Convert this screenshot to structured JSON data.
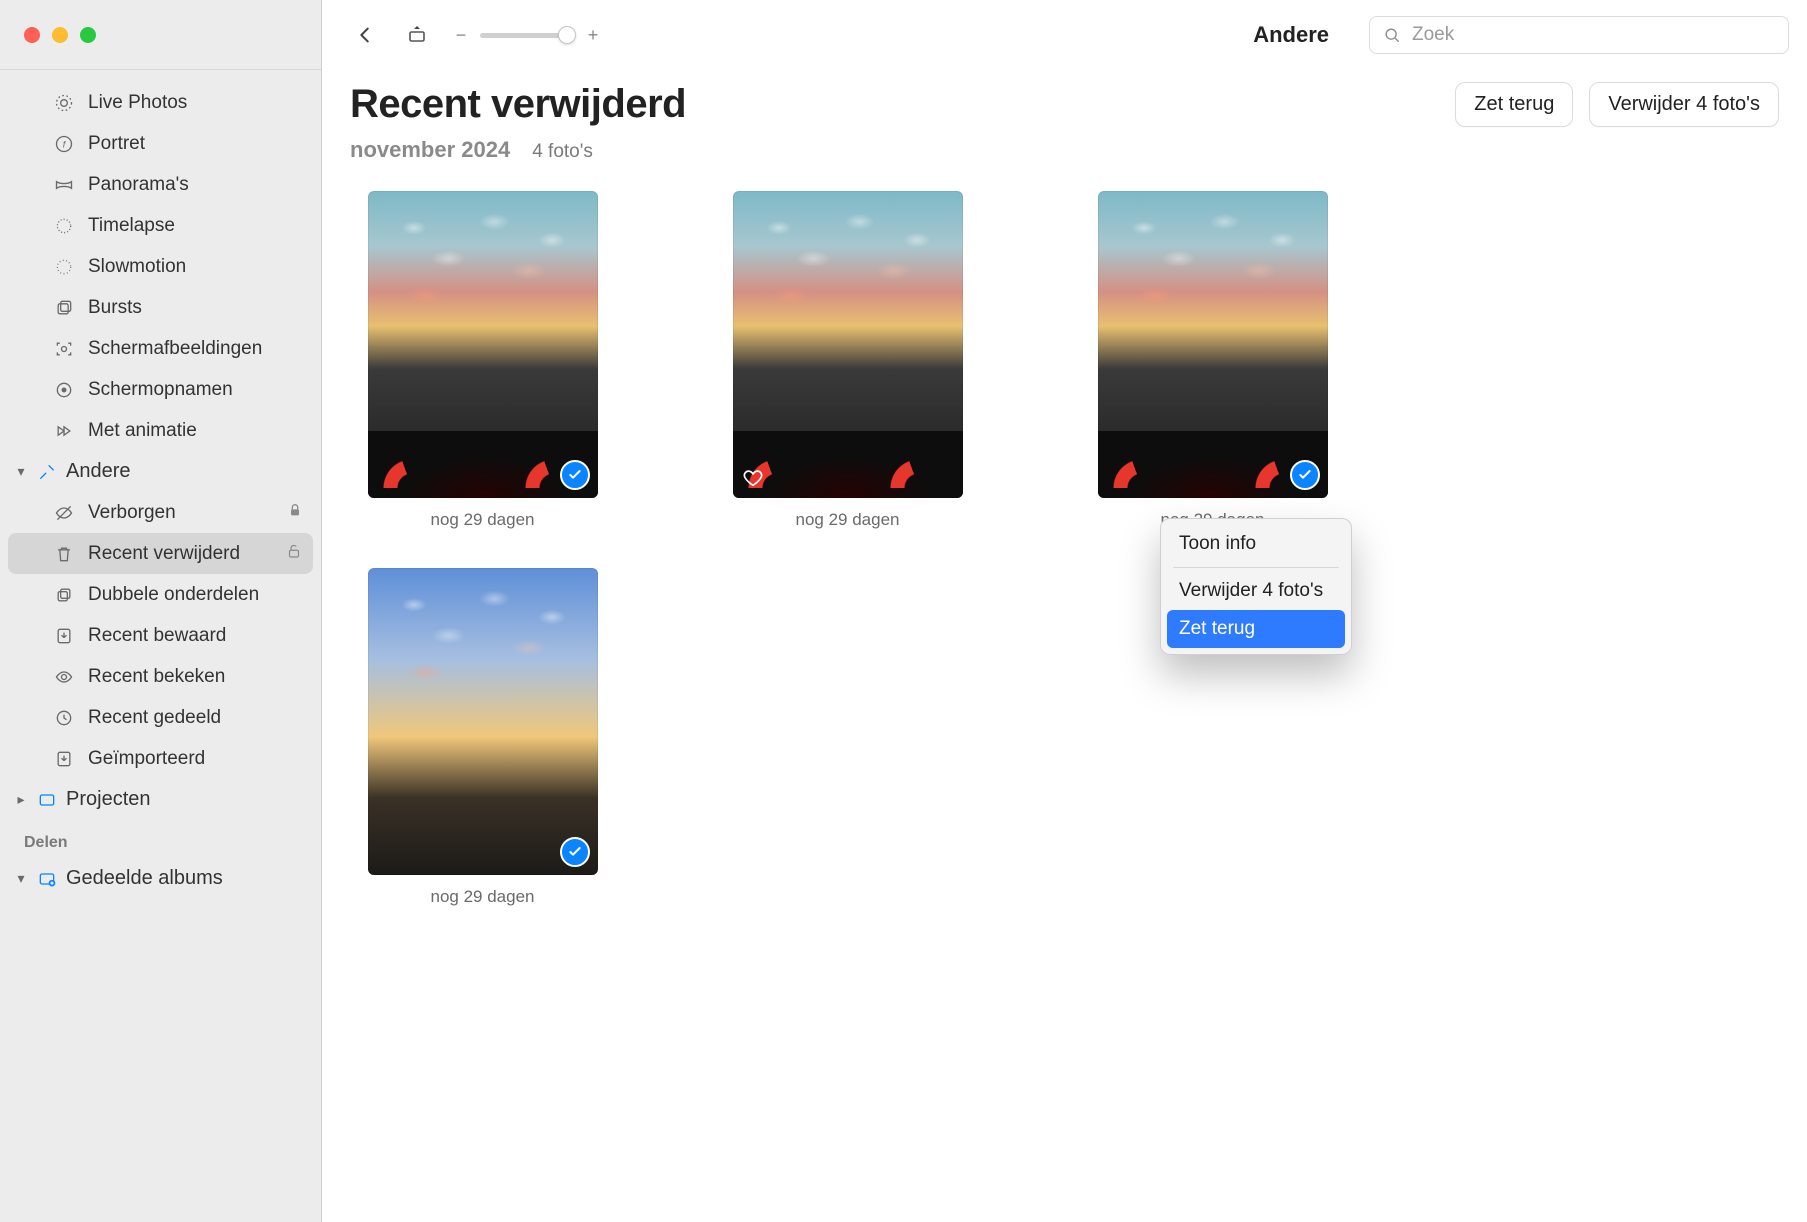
{
  "window": {
    "location_label": "Andere"
  },
  "search": {
    "placeholder": "Zoek"
  },
  "sidebar": {
    "items": [
      {
        "label": "Live Photos",
        "icon": "livephotos"
      },
      {
        "label": "Portret",
        "icon": "portrait"
      },
      {
        "label": "Panorama's",
        "icon": "panorama"
      },
      {
        "label": "Timelapse",
        "icon": "timelapse"
      },
      {
        "label": "Slowmotion",
        "icon": "slowmotion"
      },
      {
        "label": "Bursts",
        "icon": "bursts"
      },
      {
        "label": "Schermafbeeldingen",
        "icon": "screenshot"
      },
      {
        "label": "Schermopnamen",
        "icon": "screenrec"
      },
      {
        "label": "Met animatie",
        "icon": "animated"
      }
    ],
    "andere_header": "Andere",
    "andere": [
      {
        "label": "Verborgen",
        "icon": "hidden",
        "locked": true
      },
      {
        "label": "Recent verwijderd",
        "icon": "trash",
        "unlocked": true,
        "selected": true
      },
      {
        "label": "Dubbele onderdelen",
        "icon": "duplicates"
      },
      {
        "label": "Recent bewaard",
        "icon": "saved"
      },
      {
        "label": "Recent bekeken",
        "icon": "viewed"
      },
      {
        "label": "Recent gedeeld",
        "icon": "shared"
      },
      {
        "label": "Geïmporteerd",
        "icon": "imported"
      }
    ],
    "projecten_header": "Projecten",
    "delen_label": "Delen",
    "gedeelde_header": "Gedeelde albums"
  },
  "page": {
    "title": "Recent verwijderd",
    "subtitle_date": "november 2024",
    "subtitle_count": "4 foto's",
    "actions": {
      "recover": "Zet terug",
      "delete": "Verwijder 4 foto's"
    }
  },
  "grid": {
    "items": [
      {
        "caption": "nog 29 dagen",
        "selected": true,
        "favorite": false,
        "variant": "street"
      },
      {
        "caption": "nog 29 dagen",
        "selected": false,
        "favorite": true,
        "variant": "street"
      },
      {
        "caption": "nog 29 dagen",
        "selected": true,
        "favorite": false,
        "variant": "street"
      },
      {
        "caption": "nog 29 dagen",
        "selected": true,
        "favorite": false,
        "variant": "sky2"
      }
    ]
  },
  "context_menu": {
    "items": [
      {
        "label": "Toon info"
      },
      {
        "label": "Verwijder 4 foto's"
      },
      {
        "label": "Zet terug",
        "highlight": true
      }
    ]
  }
}
